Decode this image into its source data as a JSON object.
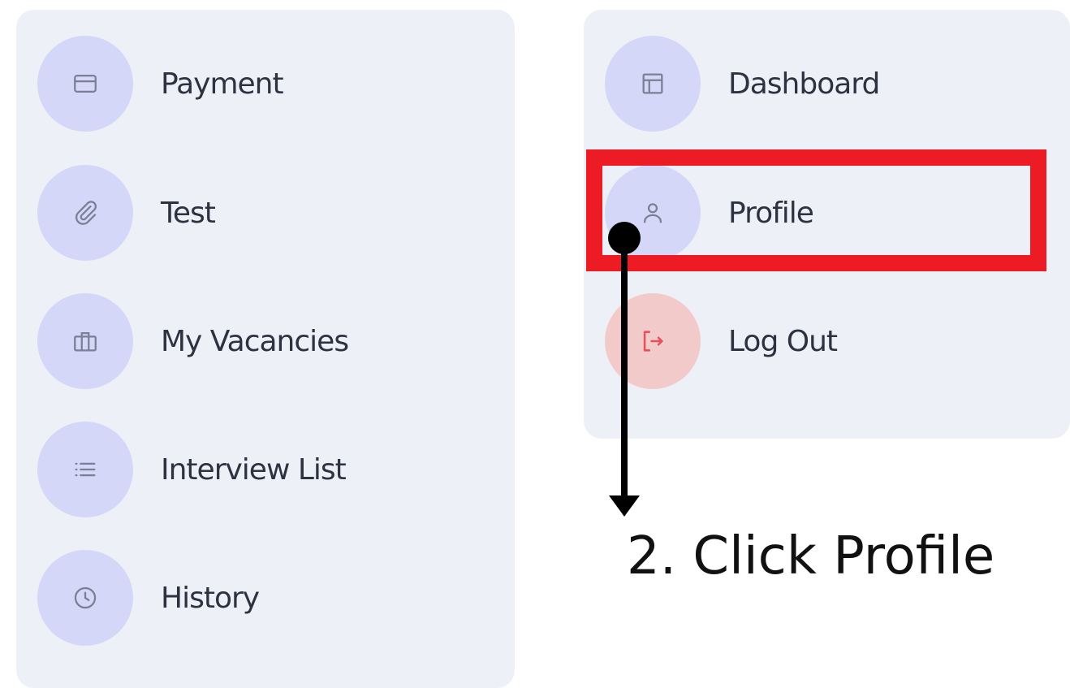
{
  "left_menu": {
    "items": [
      {
        "label": "Payment",
        "icon": "card-icon"
      },
      {
        "label": "Test",
        "icon": "paperclip-icon"
      },
      {
        "label": "My Vacancies",
        "icon": "briefcase-icon"
      },
      {
        "label": "Interview List",
        "icon": "list-icon"
      },
      {
        "label": "History",
        "icon": "clock-icon"
      }
    ]
  },
  "right_menu": {
    "items": [
      {
        "label": "Dashboard",
        "icon": "layout-icon"
      },
      {
        "label": "Profile",
        "icon": "user-icon"
      },
      {
        "label": "Log Out",
        "icon": "logout-icon"
      }
    ]
  },
  "annotation": {
    "instruction": "2. Click Profile"
  },
  "colors": {
    "panel_bg": "#eef0f8",
    "icon_circle": "#d4d7f7",
    "logout_circle": "#f3caca",
    "highlight": "#ed1c24",
    "icon_stroke": "#7b7f95",
    "logout_icon": "#e8505b"
  }
}
